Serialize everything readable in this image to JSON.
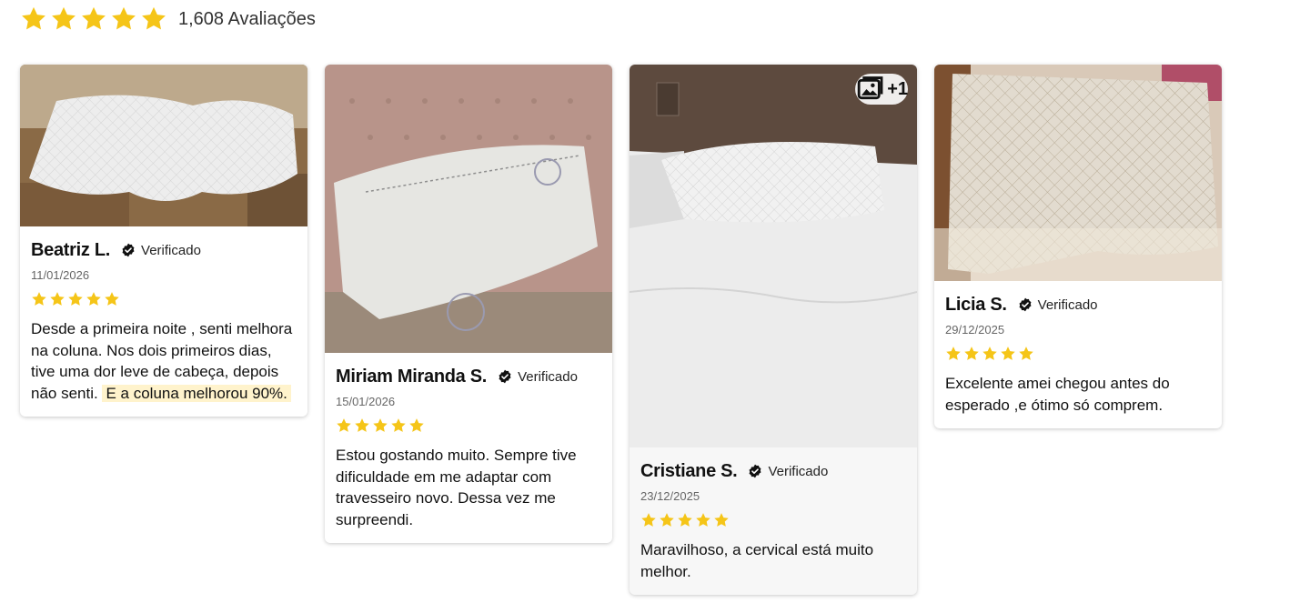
{
  "summary": {
    "stars": 5,
    "count_label": "1,608 Avaliações",
    "star_color": "#f5c518"
  },
  "reviews": [
    {
      "name": "Beatriz L.",
      "verified_label": "Verificado",
      "date": "11/01/2026",
      "rating": 5,
      "text": "Desde a primeira noite , senti melhora na coluna. Nos dois primeiros dias, tive uma dor leve de cabeça, depois não senti.",
      "highlight": "E a coluna melhorou 90%."
    },
    {
      "name": "Miriam Miranda S.",
      "verified_label": "Verificado",
      "date": "15/01/2026",
      "rating": 5,
      "text": "Estou gostando muito. Sempre tive dificuldade em me adaptar com travesseiro novo.  Dessa vez me surpreendi."
    },
    {
      "name": "Cristiane S.",
      "verified_label": "Verificado",
      "date": "23/12/2025",
      "rating": 5,
      "text": "Maravilhoso, a cervical está muito melhor.",
      "photo_badge": "+1"
    },
    {
      "name": "Licia S.",
      "verified_label": "Verificado",
      "date": "29/12/2025",
      "rating": 5,
      "text": "Excelente amei chegou antes do esperado ,e ótimo só comprem."
    }
  ]
}
